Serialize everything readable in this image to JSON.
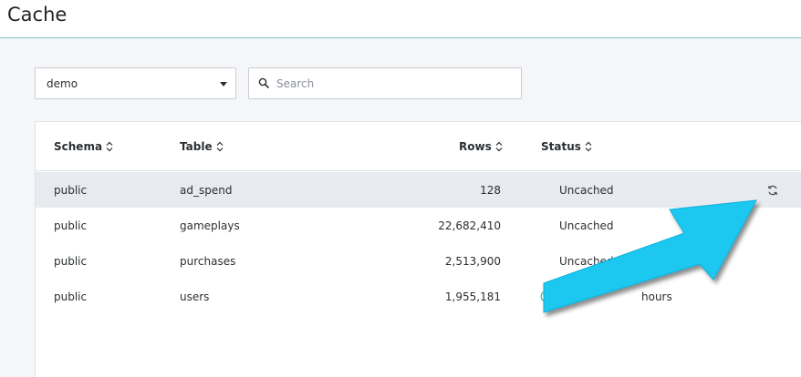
{
  "page": {
    "title": "Cache"
  },
  "schema_select": {
    "value": "demo"
  },
  "search": {
    "placeholder": "Search",
    "value": ""
  },
  "table": {
    "columns": {
      "schema": "Schema",
      "table": "Table",
      "rows": "Rows",
      "status": "Status"
    },
    "rows": [
      {
        "schema": "public",
        "table": "ad_spend",
        "rows": "128",
        "status": "Uncached"
      },
      {
        "schema": "public",
        "table": "gameplays",
        "rows": "22,682,410",
        "status": "Uncached"
      },
      {
        "schema": "public",
        "table": "purchases",
        "rows": "2,513,900",
        "status": "Uncached"
      },
      {
        "schema": "public",
        "table": "users",
        "rows": "1,955,181",
        "status_prefix": "N",
        "status_suffix": "hours"
      }
    ]
  },
  "icons": {
    "search": "search-icon",
    "sort": "sort-icon",
    "refresh": "refresh-icon",
    "check": "check-circle-icon",
    "caret": "chevron-down-icon"
  },
  "colors": {
    "accent_line": "#7fc4c8",
    "check_green": "#3fb39a",
    "arrow_fill": "#1ec8f0"
  }
}
